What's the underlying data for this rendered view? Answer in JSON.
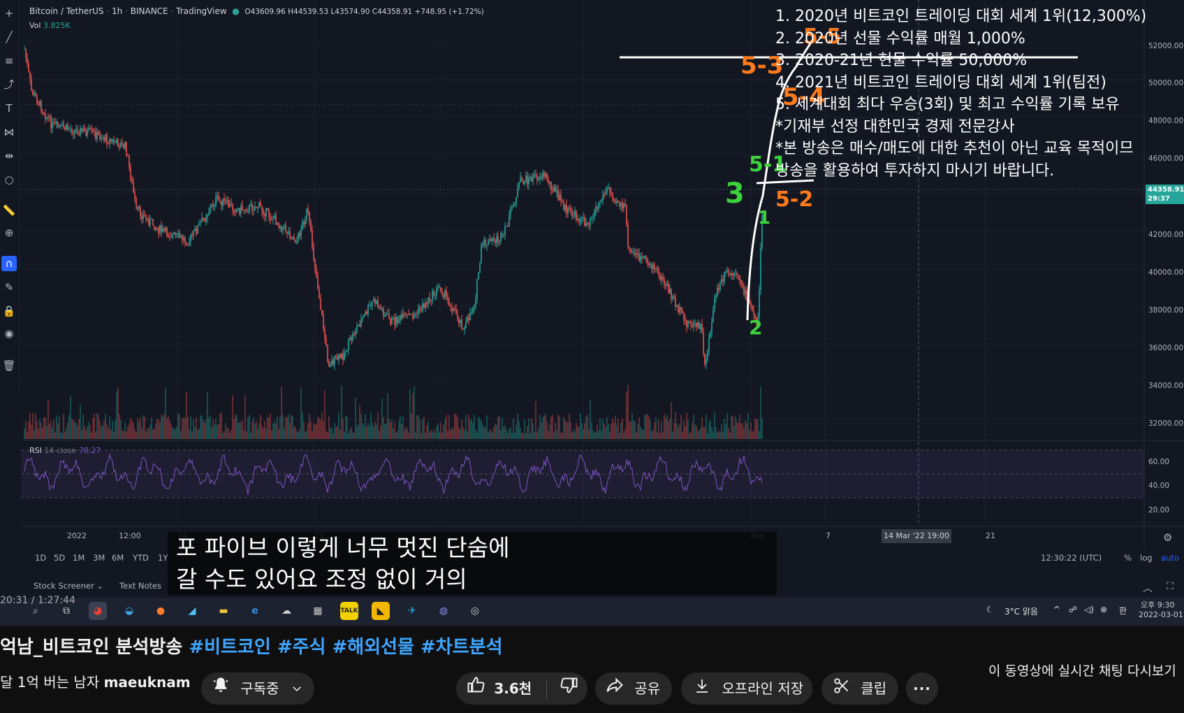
{
  "chart_header": {
    "symbol": "Bitcoin / TetherUS",
    "interval": "1h",
    "exchange": "BINANCE",
    "source": "TradingView",
    "ohlc": "O43609.96 H44539.53 L43574.90 C44358.91 +748.95 (+1.72%)",
    "vol_label": "Vol",
    "vol_value": "3.825K",
    "rsi_label": "RSI",
    "rsi_params": "14 close",
    "rsi_value": "78.27"
  },
  "overlay_lines": [
    "1. 2020년 비트코인 트레이딩 대회 세계 1위(12,300%)",
    "2. 2020년 선물 수익률 매월 1,000%",
    "3. 2020-21년 현물 수익률 50,000%",
    "4. 2021년 비트코인 트레이딩 대회 세계 1위(팀전)",
    "5. 세계대회 최다 우승(3회) 및 최고 수익률 기록 보유",
    "*기재부 선정 대한민국 경제 전문강사",
    "*본 방송은 매수/매도에 대한 추천이 아닌 교육 목적이므",
    " 방송을 활용하여 투자하지 마시기 바랍니다."
  ],
  "annotations": [
    "5-3",
    "5-4",
    "5-5",
    "5-1",
    "3",
    "5-2",
    "1",
    "2"
  ],
  "price_axis": [
    "52000.00",
    "50000.00",
    "48000.00",
    "46000.00",
    "42000.00",
    "40000.00",
    "38000.00",
    "36000.00",
    "34000.00",
    "32000.00"
  ],
  "rsi_axis": [
    "60.00",
    "40.00",
    "20.00"
  ],
  "last_price": "44358.91",
  "countdown": "29:37",
  "time_axis": [
    "2022",
    "12:00",
    "14",
    "21",
    "Mar",
    "7",
    "21"
  ],
  "crosshair_time": "14 Mar '22   19:00",
  "timeframes": [
    "1D",
    "5D",
    "1M",
    "3M",
    "6M",
    "YTD",
    "1Y"
  ],
  "clock": "12:30:22 (UTC)",
  "scale_opts": [
    "%",
    "log",
    "auto"
  ],
  "bottom_tabs": [
    "Stock Screener",
    "Text Notes"
  ],
  "subtitle_lines": [
    "포 파이브 이렇게 너무 멋진 단숨에",
    "갈 수도 있어요 조정 없이 거의"
  ],
  "video_time": "20:31 / 1:27:44",
  "taskbar": {
    "weather": "3°C 맑음",
    "time": "오후 9:30",
    "date": "2022-03-01"
  },
  "yt": {
    "title_plain": "억남_비트코인 분석방송 ",
    "title_tags": "#비트코인 #주식 #해외선물 #차트분석",
    "channel_prefix": "달 1억 버는 남자 ",
    "channel_name": "maeuknam",
    "subscribed": "구독중",
    "likes": "3.6천",
    "share": "공유",
    "download": "오프라인 저장",
    "clip": "클립",
    "replay_chat": "이 동영상에 실시간 채팅 다시보기"
  }
}
